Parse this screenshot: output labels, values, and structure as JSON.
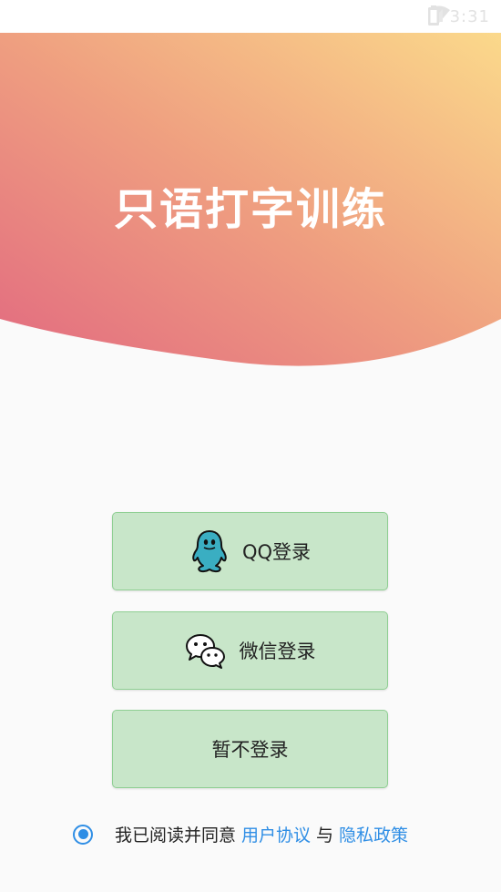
{
  "status_bar": {
    "time": "3:31"
  },
  "header": {
    "title": "只语打字训练",
    "gradient": [
      "#e26a80",
      "#ef9f80",
      "#fbd98b"
    ]
  },
  "buttons": {
    "qq_login": "QQ登录",
    "wechat_login": "微信登录",
    "skip_login": "暂不登录"
  },
  "agreement": {
    "checked": true,
    "prefix": "我已阅读并同意",
    "user_agreement": "用户协议",
    "and": "与",
    "privacy_policy": "隐私政策"
  },
  "colors": {
    "button_bg": "#c8e6c9",
    "button_border": "#8fcf93",
    "link": "#2f8ee5",
    "qq_icon": "#3aaec2"
  },
  "icons": {
    "qq": "qq-penguin-icon",
    "wechat": "wechat-bubbles-icon"
  }
}
